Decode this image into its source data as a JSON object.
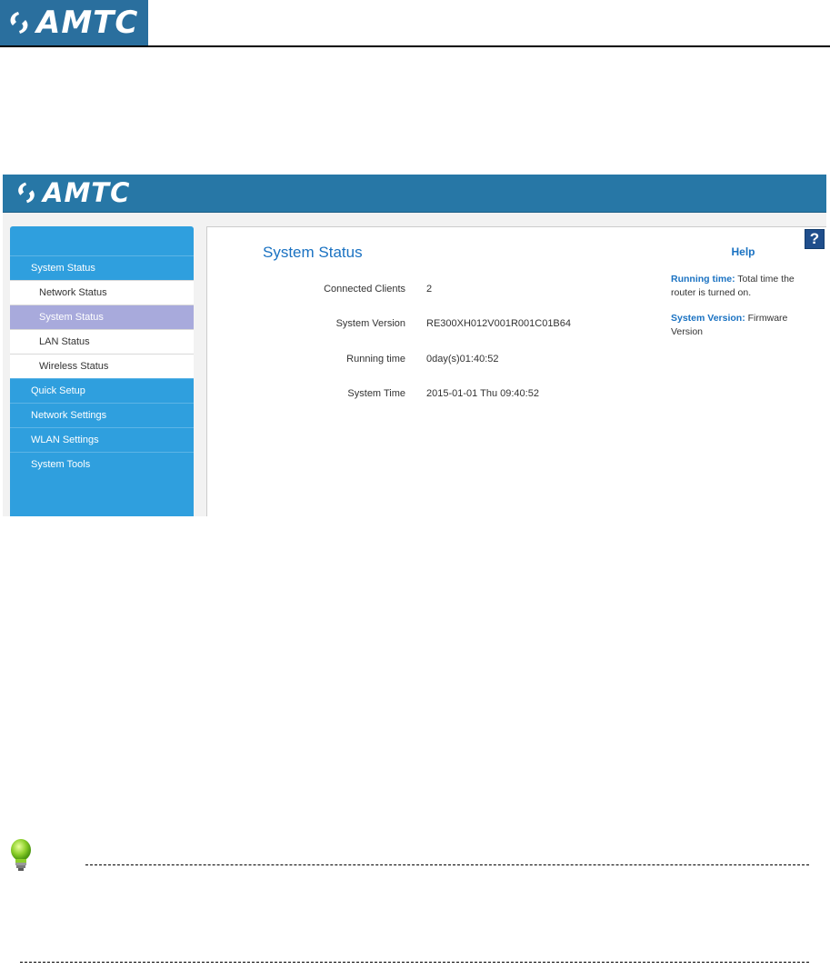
{
  "document": {
    "logo_text": "AMTC",
    "logo_icon": "amtc-swirl-logo"
  },
  "app": {
    "logo_text": "AMTC",
    "logo_icon": "amtc-swirl-logo",
    "colors": {
      "topbar": "#2777a6",
      "sidebar": "#2f9fde",
      "active": "#a8aadc",
      "accent": "#1a72c2"
    }
  },
  "sidebar": {
    "items": [
      {
        "label": "System Status",
        "type": "main"
      },
      {
        "label": "Network Status",
        "type": "sub"
      },
      {
        "label": "System Status",
        "type": "sub",
        "active": true
      },
      {
        "label": "LAN Status",
        "type": "sub"
      },
      {
        "label": "Wireless Status",
        "type": "sub"
      },
      {
        "label": "Quick Setup",
        "type": "main"
      },
      {
        "label": "Network Settings",
        "type": "main"
      },
      {
        "label": "WLAN Settings",
        "type": "main"
      },
      {
        "label": "System Tools",
        "type": "main"
      }
    ]
  },
  "main": {
    "title": "System Status",
    "rows": [
      {
        "label": "Connected Clients",
        "value": "2"
      },
      {
        "label": "System Version",
        "value": "RE300XH012V001R001C01B64"
      },
      {
        "label": "Running time",
        "value": "0day(s)01:40:52"
      },
      {
        "label": "System Time",
        "value": "2015-01-01 Thu 09:40:52"
      }
    ]
  },
  "help": {
    "icon_label": "?",
    "title": "Help",
    "items": [
      {
        "term": "Running time:",
        "text": " Total time the router is turned on."
      },
      {
        "term": "System Version:",
        "text": " Firmware Version"
      }
    ]
  },
  "note": {
    "icon": "lightbulb-icon"
  }
}
